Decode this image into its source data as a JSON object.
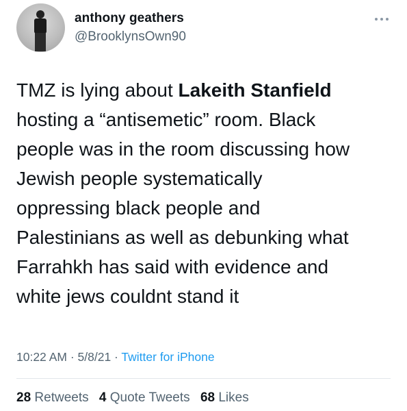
{
  "author": {
    "display_name": "anthony geathers",
    "handle": "@BrooklynsOwn90"
  },
  "tweet": {
    "line1_pre": "TMZ is lying about ",
    "line1_bold": "Lakeith Stanfield",
    "lines": [
      "hosting a “antisemetic” room. Black",
      "people was in the room discussing how",
      "Jewish people systematically",
      "oppressing black people and",
      "Palestinians as well as debunking what",
      "Farrahkh has said with evidence and",
      "white jews couldnt stand it"
    ]
  },
  "meta": {
    "time": "10:22 AM",
    "sep1": " · ",
    "date": "5/8/21",
    "sep2": " · ",
    "source": "Twitter for iPhone"
  },
  "stats": {
    "retweets_count": "28",
    "retweets_label": "Retweets",
    "quotes_count": "4",
    "quotes_label": "Quote Tweets",
    "likes_count": "68",
    "likes_label": "Likes"
  },
  "colors": {
    "text": "#0f1419",
    "secondary": "#536471",
    "link": "#1d9bf0"
  },
  "icons": {
    "more": "more-horizontal-icon"
  }
}
